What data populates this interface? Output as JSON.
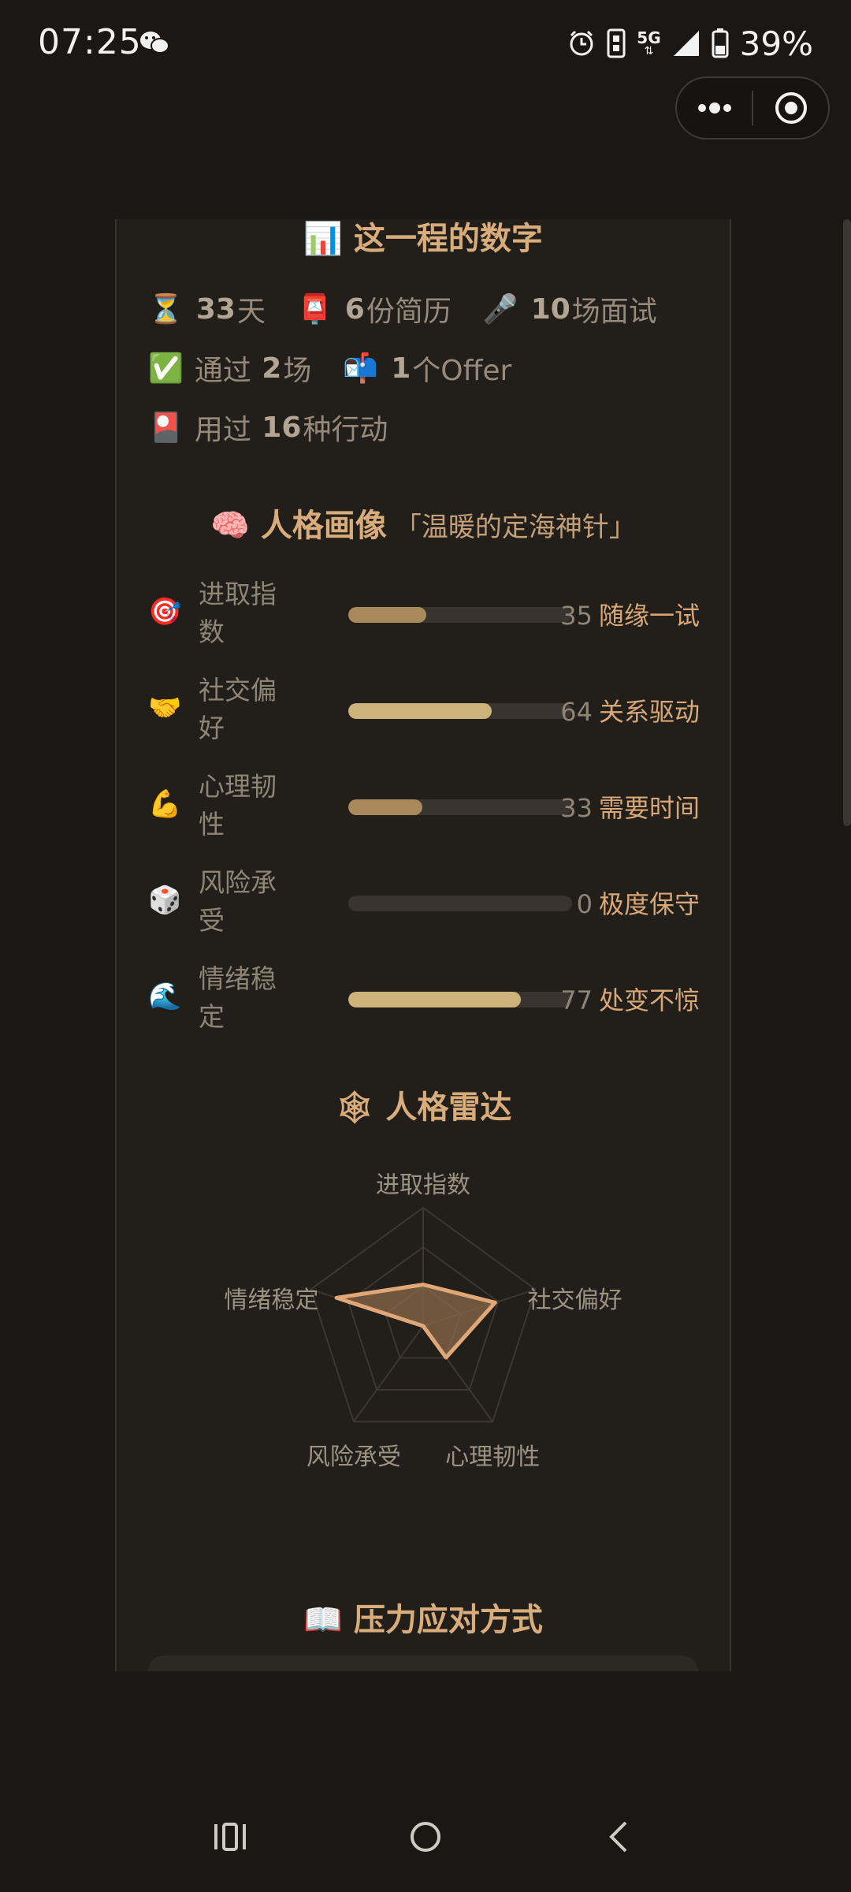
{
  "status_bar": {
    "time": "07:25",
    "signal_label": "5G",
    "battery": "39%"
  },
  "capsule": {
    "more_icon": "more-dots-icon",
    "close_icon": "target-circle-icon"
  },
  "numbers_section": {
    "title_emoji": "📊",
    "title": "这一程的数字",
    "stats": [
      {
        "icon": "⏳",
        "value": "33",
        "unit": "天"
      },
      {
        "icon": "📮",
        "value": "6",
        "unit": "份简历"
      },
      {
        "icon": "🎤",
        "value": "10",
        "unit": "场面试"
      },
      {
        "icon": "✅",
        "prefix": "通过",
        "value": "2",
        "unit": "场"
      },
      {
        "icon": "📬",
        "value": "1",
        "unit": "个Offer"
      },
      {
        "icon": "🎴",
        "prefix": "用过",
        "value": "16",
        "unit": "种行动"
      }
    ]
  },
  "persona_section": {
    "title_emoji": "🧠",
    "title": "人格画像",
    "subtitle": "「温暖的定海神针」",
    "traits": [
      {
        "icon": "🎯",
        "name": "进取指数",
        "value": 35,
        "display": "35",
        "label": "随缘一试",
        "color": "#a88a5c"
      },
      {
        "icon": "🤝",
        "name": "社交偏好",
        "value": 64,
        "display": "64",
        "label": "关系驱动",
        "color": "#cdb27a"
      },
      {
        "icon": "💪",
        "name": "心理韧性",
        "value": 33,
        "display": "33",
        "label": "需要时间",
        "color": "#a88a5c"
      },
      {
        "icon": "🎲",
        "name": "风险承受",
        "value": 0,
        "display": "0",
        "label": "极度保守",
        "color": "#a88a5c"
      },
      {
        "icon": "🌊",
        "name": "情绪稳定",
        "value": 77,
        "display": "77",
        "label": "处变不惊",
        "color": "#cdb27a"
      }
    ]
  },
  "radar_section": {
    "title_emoji": "🕸",
    "title": "人格雷达",
    "axes": [
      "进取指数",
      "社交偏好",
      "心理韧性",
      "风险承受",
      "情绪稳定"
    ],
    "values": [
      35,
      64,
      33,
      0,
      77
    ],
    "max": 100,
    "fill_color": "#8a6a4a",
    "stroke_color": "#e0a878"
  },
  "coping_section": {
    "title_emoji": "📖",
    "title": "压力应对方式"
  },
  "nav_bar": {
    "recent_icon": "recent-apps-icon",
    "home_icon": "home-circle-icon",
    "back_icon": "back-chevron-icon"
  }
}
